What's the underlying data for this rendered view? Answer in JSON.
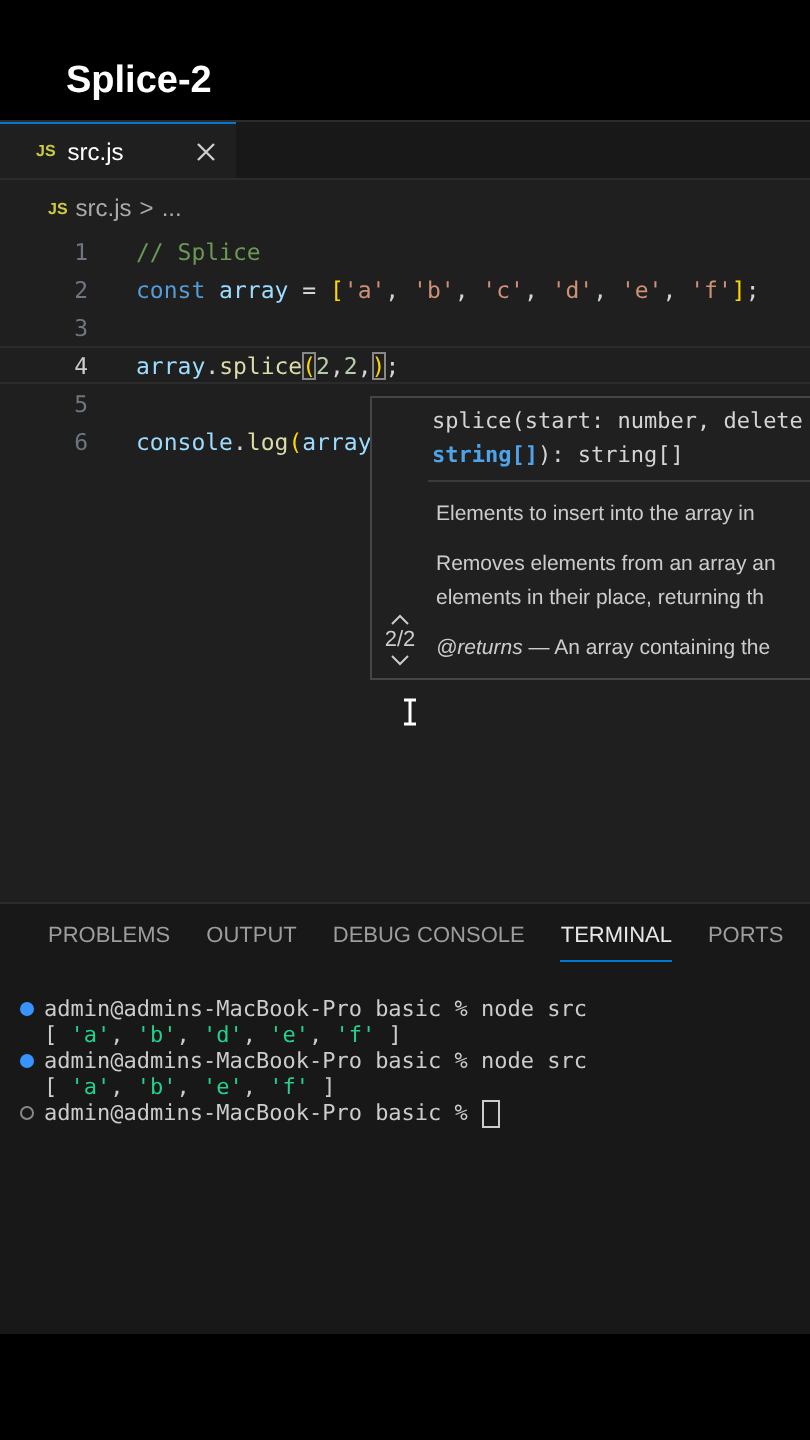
{
  "video_title": "Splice-2",
  "tabs": [
    {
      "label": "src.js",
      "badge": "JS",
      "selected": true,
      "closable": true
    }
  ],
  "breadcrumb": {
    "badge": "JS",
    "file": "src.js",
    "separator": ">",
    "rest": "..."
  },
  "code_lines": [
    {
      "number": "1",
      "active": false,
      "tokens": [
        {
          "text": "// Splice",
          "kind": "comment"
        }
      ]
    },
    {
      "number": "2",
      "active": false,
      "tokens": [
        {
          "text": "const ",
          "kind": "keyword"
        },
        {
          "text": "array",
          "kind": "variable"
        },
        {
          "text": " = ",
          "kind": "plain"
        },
        {
          "text": "[",
          "kind": "bracket"
        },
        {
          "text": "'a'",
          "kind": "string"
        },
        {
          "text": ", ",
          "kind": "plain"
        },
        {
          "text": "'b'",
          "kind": "string"
        },
        {
          "text": ", ",
          "kind": "plain"
        },
        {
          "text": "'c'",
          "kind": "string"
        },
        {
          "text": ", ",
          "kind": "plain"
        },
        {
          "text": "'d'",
          "kind": "string"
        },
        {
          "text": ", ",
          "kind": "plain"
        },
        {
          "text": "'e'",
          "kind": "string"
        },
        {
          "text": ", ",
          "kind": "plain"
        },
        {
          "text": "'f'",
          "kind": "string"
        },
        {
          "text": "]",
          "kind": "bracket"
        },
        {
          "text": ";",
          "kind": "plain"
        }
      ]
    },
    {
      "number": "3",
      "active": false
    },
    {
      "number": "4",
      "active": true,
      "tokens": [
        {
          "text": "array",
          "kind": "variable"
        },
        {
          "text": ".",
          "kind": "plain"
        },
        {
          "text": "splice",
          "kind": "function"
        },
        {
          "text": "(",
          "kind": "bracket_match"
        },
        {
          "text": "2",
          "kind": "number"
        },
        {
          "text": ",",
          "kind": "plain"
        },
        {
          "text": "2",
          "kind": "number"
        },
        {
          "text": ",",
          "kind": "plain"
        },
        {
          "text": ")",
          "kind": "bracket_match"
        },
        {
          "text": ";",
          "kind": "plain"
        }
      ]
    },
    {
      "number": "5",
      "active": false
    },
    {
      "number": "6",
      "active": false,
      "tokens": [
        {
          "text": "console",
          "kind": "variable"
        },
        {
          "text": ".",
          "kind": "plain"
        },
        {
          "text": "log",
          "kind": "function"
        },
        {
          "text": "(",
          "kind": "bracket"
        },
        {
          "text": "array",
          "kind": "variable"
        }
      ]
    }
  ],
  "signature_popup": {
    "counter": "2/2",
    "signature": [
      [
        {
          "text": "splice(start: number, delete",
          "kind": "plain"
        }
      ],
      [
        {
          "text": "string[]",
          "kind": "active_param"
        },
        {
          "text": "): string[]",
          "kind": "plain"
        }
      ]
    ],
    "param_doc": "Elements to insert into the array in",
    "description": [
      "Removes elements from an array an",
      "elements in their place, returning th"
    ],
    "returns": "*@returns* — An array containing the"
  },
  "panel_tabs": [
    {
      "label": "PROBLEMS",
      "selected": false
    },
    {
      "label": "OUTPUT",
      "selected": false
    },
    {
      "label": "DEBUG CONSOLE",
      "selected": false
    },
    {
      "label": "TERMINAL",
      "selected": true
    },
    {
      "label": "PORTS",
      "selected": false
    }
  ],
  "terminal_lines": [
    {
      "kind": "prompt",
      "finished": true,
      "text": "admin@admins-MacBook-Pro basic % node src"
    },
    {
      "kind": "output",
      "tokens": [
        {
          "text": "[ ",
          "kind": "plain"
        },
        {
          "text": "'a'",
          "kind": "string"
        },
        {
          "text": ", ",
          "kind": "plain"
        },
        {
          "text": "'b'",
          "kind": "string"
        },
        {
          "text": ", ",
          "kind": "plain"
        },
        {
          "text": "'d'",
          "kind": "string"
        },
        {
          "text": ", ",
          "kind": "plain"
        },
        {
          "text": "'e'",
          "kind": "string"
        },
        {
          "text": ", ",
          "kind": "plain"
        },
        {
          "text": "'f'",
          "kind": "string"
        },
        {
          "text": " ]",
          "kind": "plain"
        }
      ]
    },
    {
      "kind": "prompt",
      "finished": true,
      "text": "admin@admins-MacBook-Pro basic % node src"
    },
    {
      "kind": "output",
      "tokens": [
        {
          "text": "[ ",
          "kind": "plain"
        },
        {
          "text": "'a'",
          "kind": "string"
        },
        {
          "text": ", ",
          "kind": "plain"
        },
        {
          "text": "'b'",
          "kind": "string"
        },
        {
          "text": ", ",
          "kind": "plain"
        },
        {
          "text": "'e'",
          "kind": "string"
        },
        {
          "text": ", ",
          "kind": "plain"
        },
        {
          "text": "'f'",
          "kind": "string"
        },
        {
          "text": " ]",
          "kind": "plain"
        }
      ]
    },
    {
      "kind": "prompt",
      "finished": false,
      "cursor": true,
      "text": "admin@admins-MacBook-Pro basic %"
    }
  ]
}
